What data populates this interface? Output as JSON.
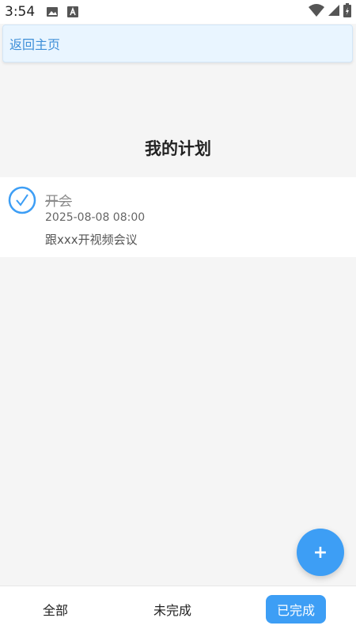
{
  "status_bar": {
    "time": "3:54",
    "icons": [
      "image-icon",
      "font-icon",
      "wifi-icon",
      "signal-icon",
      "battery-icon"
    ]
  },
  "header": {
    "back_label": "返回主页"
  },
  "page": {
    "title": "我的计划"
  },
  "plans": [
    {
      "title": "开会",
      "datetime": "2025-08-08 08:00",
      "description": "跟xxx开视频会议",
      "completed": true
    }
  ],
  "fab": {
    "label": "+"
  },
  "tabs": [
    {
      "label": "全部",
      "active": false
    },
    {
      "label": "未完成",
      "active": false
    },
    {
      "label": "已完成",
      "active": true
    }
  ],
  "colors": {
    "accent": "#3d9ef5",
    "link": "#3e8fd8",
    "header_bg": "#e9f5ff",
    "page_bg": "#f5f5f5"
  }
}
